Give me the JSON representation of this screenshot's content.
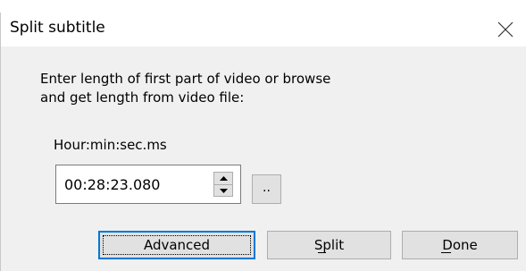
{
  "dialog": {
    "title": "Split subtitle",
    "close_icon": "close-icon",
    "prompt": "Enter length of first part of video or browse\nand get length from video file:",
    "time_label": "Hour:min:sec.ms",
    "time_value": "00:28:23.080",
    "spin_up_icon": "triangle-up-icon",
    "spin_down_icon": "triangle-down-icon",
    "browse_label": "..",
    "buttons": {
      "advanced": "Advanced",
      "split": "Split",
      "done": "Done"
    },
    "accent_color": "#0078d7"
  }
}
